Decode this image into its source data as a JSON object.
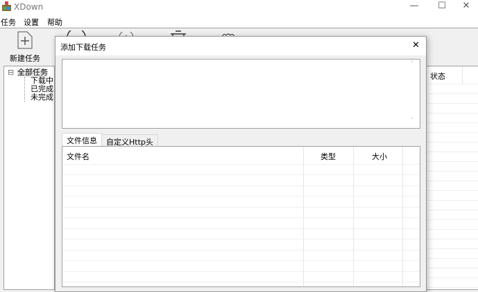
{
  "window": {
    "title": "XDown",
    "controls": {
      "minimize": "—",
      "maximize": "☐",
      "close": "✕"
    }
  },
  "menu": [
    "任务",
    "设置",
    "帮助"
  ],
  "toolbar": {
    "new_task": "新建任务"
  },
  "tree": {
    "root": "全部任务",
    "expander": "⊟",
    "children": [
      "下载中",
      "已完成",
      "未完成"
    ]
  },
  "list": {
    "columns": [
      "状态"
    ]
  },
  "dialog": {
    "title": "添加下载任务",
    "close": "✕",
    "url_value": "",
    "tabs": [
      "文件信息",
      "自定义Http头"
    ],
    "table": {
      "columns": [
        "文件名",
        "类型",
        "大小"
      ]
    }
  }
}
